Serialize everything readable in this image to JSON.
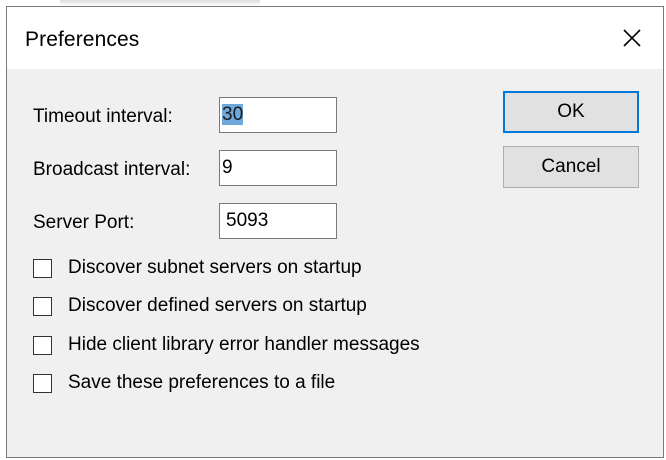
{
  "dialog": {
    "title": "Preferences",
    "close_icon": "close-icon"
  },
  "fields": {
    "timeout": {
      "label": "Timeout interval:",
      "value": "30"
    },
    "broadcast": {
      "label": "Broadcast interval:",
      "value": "9"
    },
    "port": {
      "label": "Server Port:",
      "value": "5093"
    }
  },
  "buttons": {
    "ok": "OK",
    "cancel": "Cancel"
  },
  "options": [
    {
      "label": "Discover subnet servers on startup",
      "checked": false
    },
    {
      "label": "Discover defined servers on startup",
      "checked": false
    },
    {
      "label": "Hide client library error handler messages",
      "checked": false
    },
    {
      "label": "Save these preferences to a file",
      "checked": false
    }
  ],
  "colors": {
    "accent": "#0078d7",
    "selection": "#6fa8dc",
    "dialog_bg": "#f0f0f0"
  }
}
